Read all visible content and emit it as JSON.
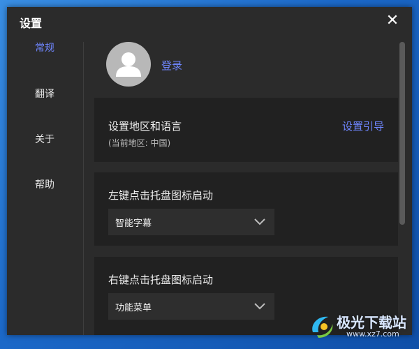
{
  "window": {
    "title": "设置"
  },
  "close_icon": "close-icon",
  "sidebar": {
    "items": [
      {
        "label": "常规",
        "active": true
      },
      {
        "label": "翻译",
        "active": false
      },
      {
        "label": "关于",
        "active": false
      },
      {
        "label": "帮助",
        "active": false
      }
    ]
  },
  "account": {
    "login_label": "登录",
    "avatar_icon": "user-icon"
  },
  "region": {
    "title": "设置地区和语言",
    "current": "(当前地区: 中国)",
    "guide_link": "设置引导"
  },
  "left_click": {
    "title": "左键点击托盘图标启动",
    "selected": "智能字幕"
  },
  "right_click": {
    "title": "右键点击托盘图标启动",
    "selected": "功能菜单"
  },
  "watermark": {
    "title": "极光下载站",
    "url": "www.xz7.com"
  },
  "colors": {
    "accent": "#6f86ff",
    "window_bg": "#2b2b2b",
    "card_bg": "#212121",
    "desktop_blue": "#1b68c8"
  }
}
